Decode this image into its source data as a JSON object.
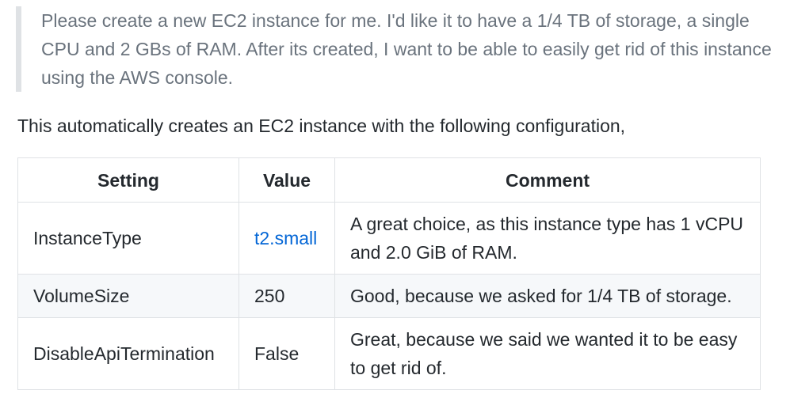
{
  "quote": {
    "text": "Please create a new EC2 instance for me. I'd like it to have a 1/4 TB of storage, a single CPU and 2 GBs of RAM. After its created, I want to be able to easily get rid of this instance using the AWS console."
  },
  "intro": {
    "text": "This automatically creates an EC2 instance with the following configuration,"
  },
  "table": {
    "headers": [
      "Setting",
      "Value",
      "Comment"
    ],
    "rows": [
      {
        "setting": "InstanceType",
        "value": "t2.small",
        "comment": "A great choice, as this instance type has 1 vCPU and 2.0 GiB of RAM."
      },
      {
        "setting": "VolumeSize",
        "value": "250",
        "comment": "Good, because we asked for 1/4 TB of storage."
      },
      {
        "setting": "DisableApiTermination",
        "value": "False",
        "comment": "Great, because we said we wanted it to be easy to get rid of."
      }
    ]
  },
  "colors": {
    "link": "#0366d6",
    "quote_text": "#6a737d",
    "quote_border": "#dfe2e5",
    "alt_row": "#f6f8fa"
  }
}
